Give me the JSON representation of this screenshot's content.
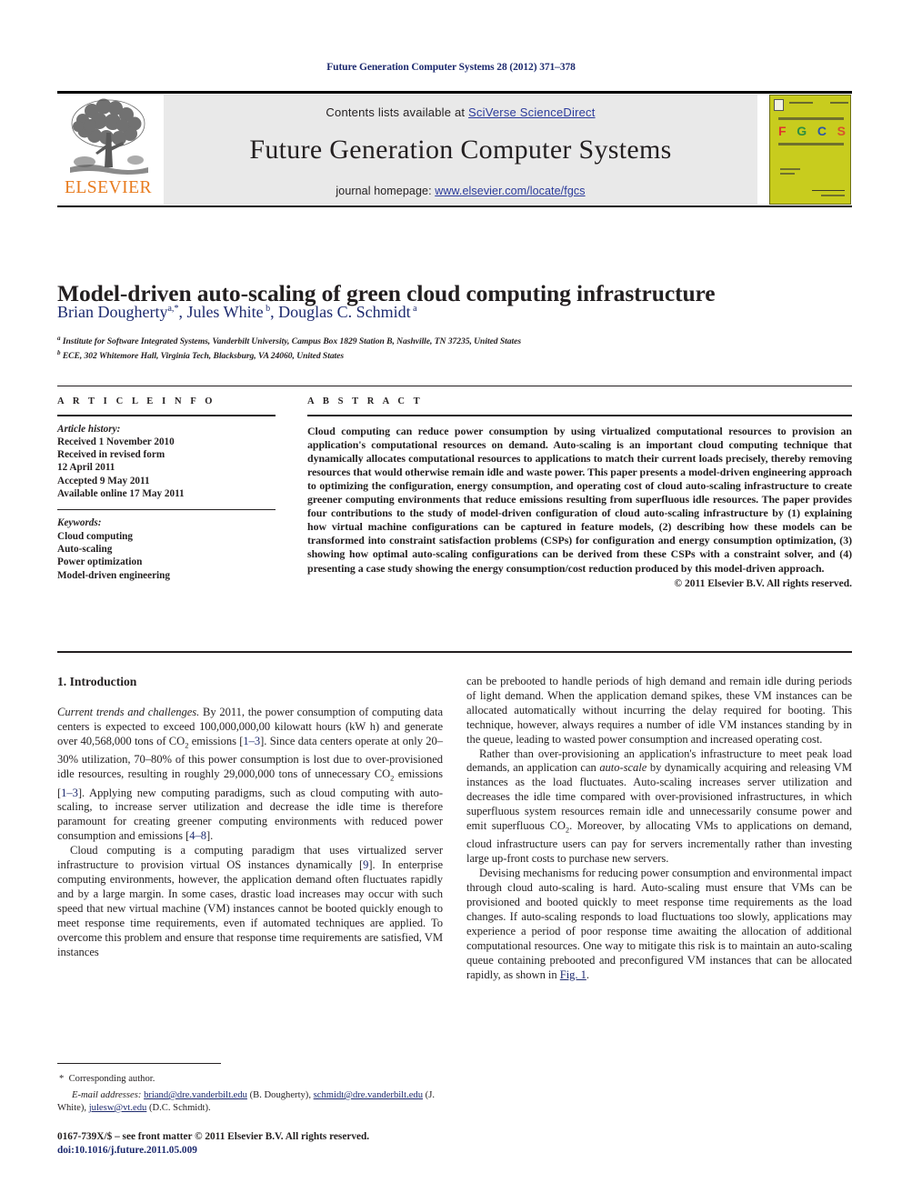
{
  "running_head": "Future Generation Computer Systems 28 (2012) 371–378",
  "banner": {
    "contents_prefix": "Contents lists available at ",
    "sciencedirect_link": "SciVerse ScienceDirect",
    "journal_name": "Future Generation Computer Systems",
    "homepage_prefix": "journal homepage: ",
    "homepage_link": "www.elsevier.com/locate/fgcs",
    "publisher_wordmark": "ELSEVIER",
    "cover_letters": [
      "F",
      "G",
      "C",
      "S"
    ],
    "cover_letter_colors": [
      "#e0352b",
      "#2f8f3f",
      "#2b56a8",
      "#d8532b"
    ],
    "cover_background": "#c8cc1e"
  },
  "article": {
    "title": "Model-driven auto-scaling of green cloud computing infrastructure",
    "authors_plain": "Brian Dougherty a,*, Jules White b, Douglas C. Schmidt a",
    "affiliation_a": "Institute for Software Integrated Systems, Vanderbilt University, Campus Box 1829 Station B, Nashville, TN 37235, United States",
    "affiliation_b": "ECE, 302 Whitemore Hall, Virginia Tech, Blacksburg, VA 24060, United States"
  },
  "article_info": {
    "heading": "A R T I C L E    I N F O",
    "history_label": "Article history:",
    "history": [
      "Received 1 November 2010",
      "Received in revised form",
      "12 April 2011",
      "Accepted 9 May 2011",
      "Available online 17 May 2011"
    ],
    "keywords_label": "Keywords:",
    "keywords": [
      "Cloud computing",
      "Auto-scaling",
      "Power optimization",
      "Model-driven engineering"
    ]
  },
  "abstract": {
    "heading": "A B S T R A C T",
    "text": "Cloud computing can reduce power consumption by using virtualized computational resources to provision an application's computational resources on demand. Auto-scaling is an important cloud computing technique that dynamically allocates computational resources to applications to match their current loads precisely, thereby removing resources that would otherwise remain idle and waste power. This paper presents a model-driven engineering approach to optimizing the configuration, energy consumption, and operating cost of cloud auto-scaling infrastructure to create greener computing environments that reduce emissions resulting from superfluous idle resources. The paper provides four contributions to the study of model-driven configuration of cloud auto-scaling infrastructure by (1) explaining how virtual machine configurations can be captured in feature models, (2) describing how these models can be transformed into constraint satisfaction problems (CSPs) for configuration and energy consumption optimization, (3) showing how optimal auto-scaling configurations can be derived from these CSPs with a constraint solver, and (4) presenting a case study showing the energy consumption/cost reduction produced by this model-driven approach.",
    "copyright": "© 2011 Elsevier B.V. All rights reserved."
  },
  "body": {
    "section_heading": "1. Introduction",
    "left_paragraph_1_lead": "Current trends and challenges.",
    "left_paragraph_1": " By 2011, the power consumption of computing data centers is expected to exceed 100,000,000,00 kilowatt hours (kW h) and generate over 40,568,000 tons of CO2 emissions [1–3]. Since data centers operate at only 20–30% utilization, 70–80% of this power consumption is lost due to over-provisioned idle resources, resulting in roughly 29,000,000 tons of unnecessary CO2 emissions [1–3]. Applying new computing paradigms, such as cloud computing with auto-scaling, to increase server utilization and decrease the idle time is therefore paramount for creating greener computing environments with reduced power consumption and emissions [4–8].",
    "left_paragraph_2": "Cloud computing is a computing paradigm that uses virtualized server infrastructure to provision virtual OS instances dynamically [9]. In enterprise computing environments, however, the application demand often fluctuates rapidly and by a large margin. In some cases, drastic load increases may occur with such speed that new virtual machine (VM) instances cannot be booted quickly enough to meet response time requirements, even if automated techniques are applied. To overcome this problem and ensure that response time requirements are satisfied, VM instances",
    "right_paragraph_1": "can be prebooted to handle periods of high demand and remain idle during periods of light demand. When the application demand spikes, these VM instances can be allocated automatically without incurring the delay required for booting. This technique, however, always requires a number of idle VM instances standing by in the queue, leading to wasted power consumption and increased operating cost.",
    "right_paragraph_2": "Rather than over-provisioning an application's infrastructure to meet peak load demands, an application can auto-scale by dynamically acquiring and releasing VM instances as the load fluctuates. Auto-scaling increases server utilization and decreases the idle time compared with over-provisioned infrastructures, in which superfluous system resources remain idle and unnecessarily consume power and emit superfluous CO2. Moreover, by allocating VMs to applications on demand, cloud infrastructure users can pay for servers incrementally rather than investing large up-front costs to purchase new servers.",
    "right_paragraph_3": "Devising mechanisms for reducing power consumption and environmental impact through cloud auto-scaling is hard. Auto-scaling must ensure that VMs can be provisioned and booted quickly to meet response time requirements as the load changes. If auto-scaling responds to load fluctuations too slowly, applications may experience a period of poor response time awaiting the allocation of additional computational resources. One way to mitigate this risk is to maintain an auto-scaling queue containing prebooted and preconfigured VM instances that can be allocated rapidly, as shown in Fig. 1.",
    "italic_term": "auto-scale",
    "fig_link": "Fig. 1"
  },
  "footnotes": {
    "corresponding": "Corresponding author.",
    "emails_label": "E-mail addresses:",
    "email_1": "briand@dre.vanderbilt.edu",
    "email_1_owner": "(B. Dougherty),",
    "email_2": "schmidt@dre.vanderbilt.edu",
    "email_2_owner": "(J. White),",
    "email_3": "julesw@vt.edu",
    "email_3_owner": "(D.C. Schmidt)."
  },
  "imprint": {
    "line_1": "0167-739X/$ – see front matter © 2011 Elsevier B.V. All rights reserved.",
    "doi": "doi:10.1016/j.future.2011.05.009"
  }
}
